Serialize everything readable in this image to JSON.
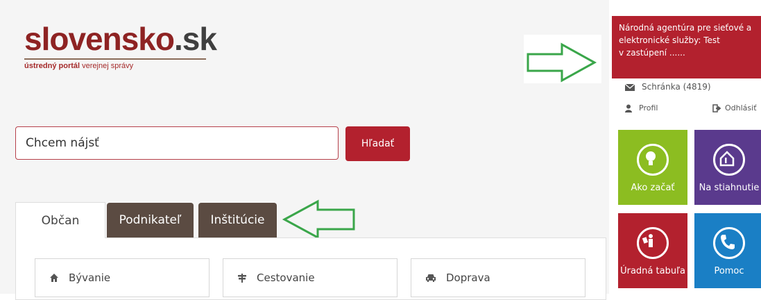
{
  "logo": {
    "brand_main": "slovensko",
    "brand_dot": ".sk",
    "tagline_bold": "ústredný portál",
    "tagline_rest": " verejnej správy"
  },
  "search": {
    "placeholder": "Chcem nájsť",
    "button_label": "Hľadať"
  },
  "tabs": [
    {
      "label": "Občan",
      "active": true
    },
    {
      "label": "Podnikateľ",
      "active": false
    },
    {
      "label": "Inštitúcie",
      "active": false
    }
  ],
  "categories": [
    {
      "label": "Bývanie",
      "icon": "home-icon"
    },
    {
      "label": "Cestovanie",
      "icon": "signpost-icon"
    },
    {
      "label": "Doprava",
      "icon": "car-icon"
    }
  ],
  "user": {
    "line1": "Národná agentúra pre sieťové a",
    "line2": "elektronické služby: Test",
    "line3": "v zastúpení ......"
  },
  "account": {
    "inbox_label": "Schránka",
    "inbox_count": "(4819)",
    "profile_label": "Profil",
    "logout_label": "Odhlásiť"
  },
  "tiles": [
    {
      "label": "Ako začať",
      "color": "#8cbd21",
      "icon": "lightbulb-icon"
    },
    {
      "label": "Na stiahnutie",
      "color": "#5a3a8d",
      "icon": "house-info-icon"
    },
    {
      "label": "Úradná tabuľa",
      "color": "#b3212e",
      "icon": "official-board-icon"
    },
    {
      "label": "Pomoc",
      "color": "#1a7fc5",
      "icon": "phone-icon"
    }
  ],
  "colors": {
    "accent": "#b3212e",
    "tab_dark": "#5b4b42",
    "annotation_arrow": "#3aa64a"
  }
}
